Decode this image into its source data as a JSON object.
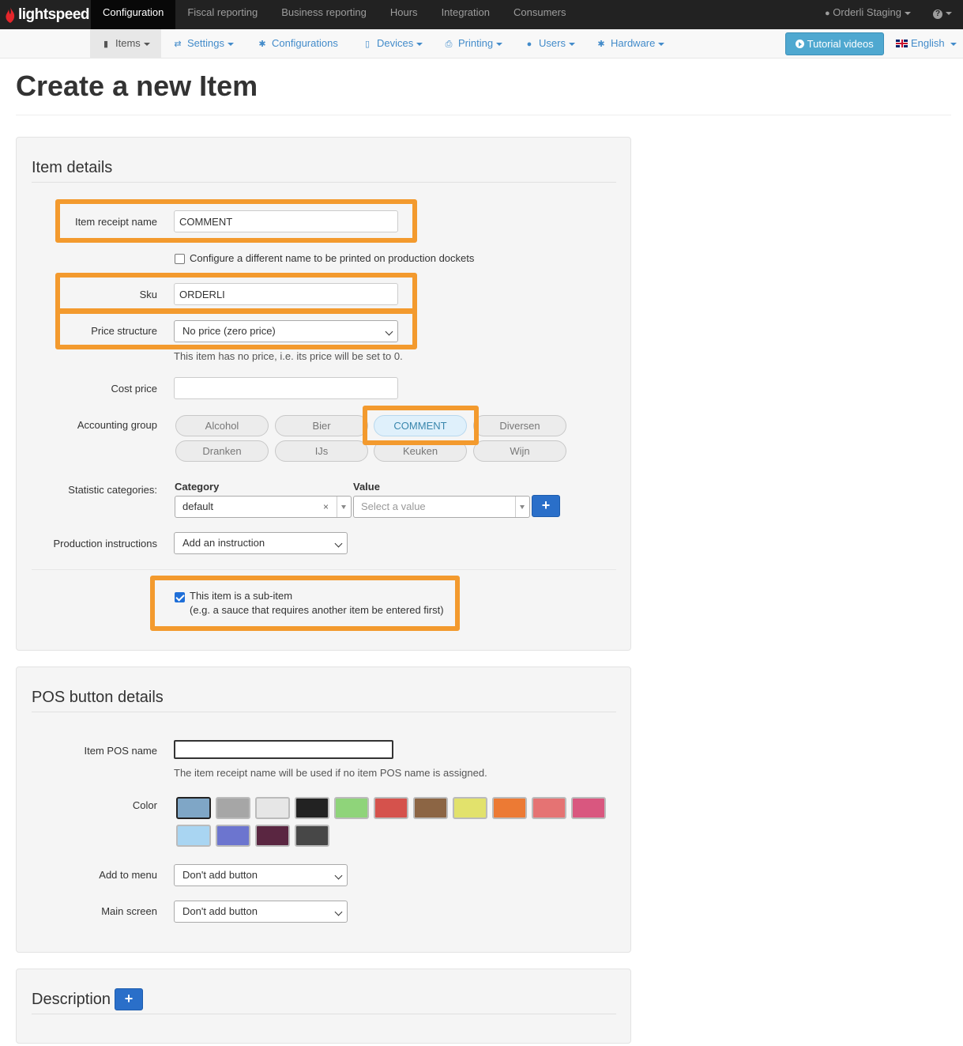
{
  "brand": {
    "name": "lightspeed"
  },
  "topnav": {
    "items": [
      "Configuration",
      "Fiscal reporting",
      "Business reporting",
      "Hours",
      "Integration",
      "Consumers"
    ],
    "account": "Orderli Staging",
    "help_icon": "question-circle-icon"
  },
  "subnav": {
    "items": [
      "Items",
      "Settings",
      "Configurations",
      "Devices",
      "Printing",
      "Users",
      "Hardware"
    ],
    "tutorial": "Tutorial videos",
    "language": "English"
  },
  "page": {
    "title": "Create a new Item"
  },
  "item_details": {
    "heading": "Item details",
    "receipt_name_label": "Item receipt name",
    "receipt_name_value": "COMMENT",
    "different_name_label": "Configure a different name to be printed on production dockets",
    "sku_label": "Sku",
    "sku_value": "ORDERLI",
    "price_structure_label": "Price structure",
    "price_structure_value": "No price (zero price)",
    "price_help": "This item has no price, i.e. its price will be set to 0.",
    "cost_price_label": "Cost price",
    "cost_price_value": "",
    "accounting_group_label": "Accounting group",
    "accounting_groups": [
      "Alcohol",
      "Bier",
      "COMMENT",
      "Diversen",
      "Dranken",
      "IJs",
      "Keuken",
      "Wijn"
    ],
    "accounting_group_selected": "COMMENT",
    "statistic_label": "Statistic categories:",
    "category_header": "Category",
    "value_header": "Value",
    "category_value": "default",
    "value_placeholder": "Select a value",
    "production_label": "Production instructions",
    "production_value": "Add an instruction",
    "subitem_line1": "This item is a sub-item",
    "subitem_line2": "(e.g. a sauce that requires another item be entered first)",
    "subitem_checked": true
  },
  "pos_button": {
    "heading": "POS button details",
    "pos_name_label": "Item POS name",
    "pos_name_value": "",
    "pos_help": "The item receipt name will be used if no item POS name is assigned.",
    "color_label": "Color",
    "colors": [
      "#7fa6c6",
      "#a6a6a6",
      "#e6e6e6",
      "#222222",
      "#8fd47a",
      "#d5524c",
      "#8c6544",
      "#e2e26c",
      "#ec7a34",
      "#e57373",
      "#d9577f",
      "#a9d5f2",
      "#6c75cf",
      "#5a2641",
      "#474747"
    ],
    "selected_color": "#7fa6c6",
    "add_menu_label": "Add to menu",
    "add_menu_value": "Don't add button",
    "main_screen_label": "Main screen",
    "main_screen_value": "Don't add button"
  },
  "description": {
    "heading": "Description"
  },
  "highlight_color": "#f39a2e"
}
